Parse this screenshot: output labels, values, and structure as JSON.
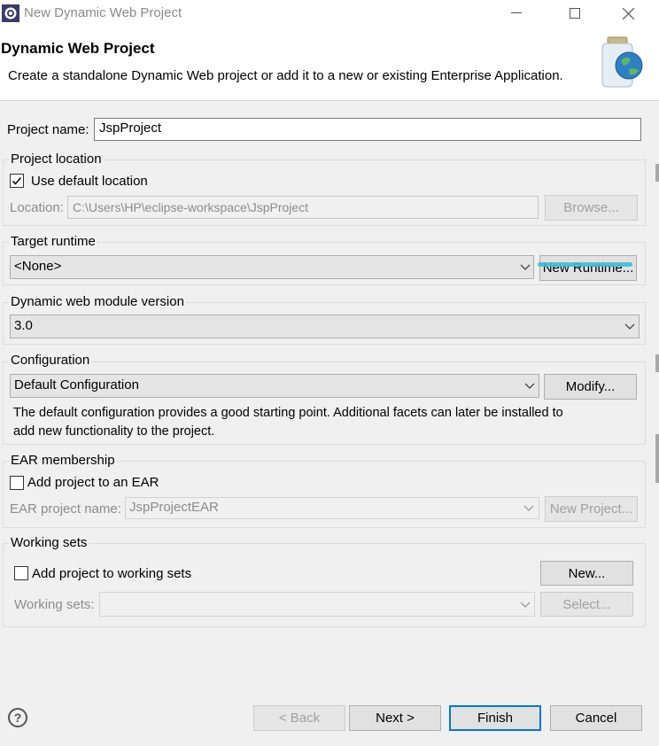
{
  "window": {
    "title": "New Dynamic Web Project",
    "minimize": "—",
    "maximize": "☐",
    "close": "✕"
  },
  "banner": {
    "title": "Dynamic Web Project",
    "description": "Create a standalone Dynamic Web project or add it to a new or existing Enterprise Application."
  },
  "project": {
    "name_label": "Project name:",
    "name_value": "JspProject"
  },
  "location": {
    "group_title": "Project location",
    "use_default_label": "Use default location",
    "use_default_checked": true,
    "location_label": "Location:",
    "location_value": "C:\\Users\\HP\\eclipse-workspace\\JspProject",
    "browse_label": "Browse..."
  },
  "runtime": {
    "group_title": "Target runtime",
    "selected": "<None>",
    "new_runtime_label": "New Runtime..."
  },
  "module": {
    "group_title": "Dynamic web module version",
    "selected": "3.0"
  },
  "configuration": {
    "group_title": "Configuration",
    "selected": "Default Configuration",
    "modify_label": "Modify...",
    "description_line1": "The default configuration provides a good starting point. Additional facets can later be installed to",
    "description_line2": "add new functionality to the project."
  },
  "ear": {
    "group_title": "EAR membership",
    "add_label": "Add project to an EAR",
    "add_checked": false,
    "project_name_label": "EAR project name:",
    "project_name_value": "JspProjectEAR",
    "new_project_label": "New Project..."
  },
  "working_sets": {
    "group_title": "Working sets",
    "add_label": "Add project to working sets",
    "add_checked": false,
    "new_label": "New...",
    "sets_label": "Working sets:",
    "sets_value": "",
    "select_label": "Select..."
  },
  "footer": {
    "help_glyph": "?",
    "back_label": "< Back",
    "next_label": "Next >",
    "finish_label": "Finish",
    "cancel_label": "Cancel"
  },
  "colors": {
    "accent": "#0078d7",
    "annotation": "#3cbfd8"
  }
}
